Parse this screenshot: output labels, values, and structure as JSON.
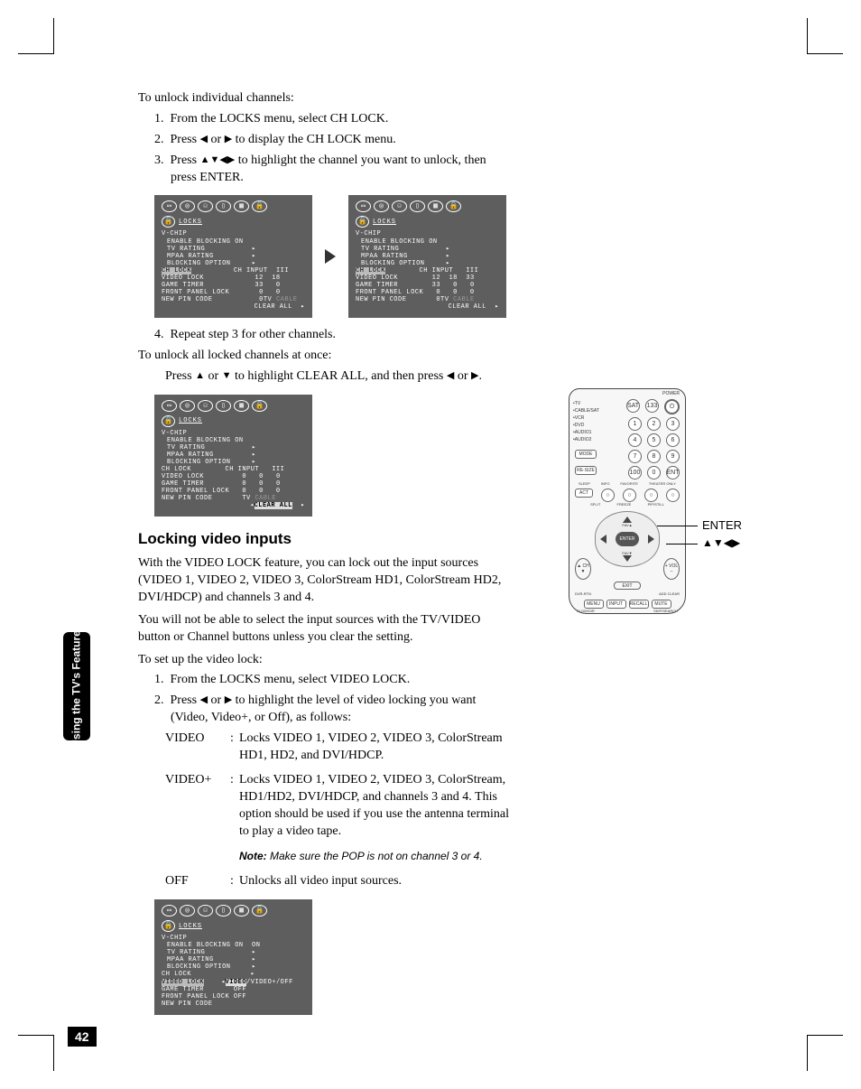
{
  "sidebar": {
    "tab": "Using the TV's\nFeatures",
    "page_num": "42"
  },
  "section1": {
    "intro": "To unlock individual channels:",
    "step1": "From the LOCKS menu, select CH LOCK.",
    "step2_a": "Press ",
    "step2_b": " or ",
    "step2_c": " to display the CH LOCK menu.",
    "step3_a": "Press ",
    "step3_b": " to highlight the channel you want to unlock, then press ENTER.",
    "step4": "Repeat step 3 for other channels.",
    "unlock_all_intro": "To unlock all locked channels at once:",
    "unlock_all_a": "Press ",
    "unlock_all_b": " or ",
    "unlock_all_c": " to highlight CLEAR ALL, and then press ",
    "unlock_all_d": " or ",
    "unlock_all_e": "."
  },
  "section2": {
    "heading": "Locking video inputs",
    "p1": "With the VIDEO LOCK feature, you can lock out the input sources (VIDEO 1, VIDEO 2, VIDEO 3, ColorStream HD1, ColorStream HD2, DVI/HDCP) and channels 3 and 4.",
    "p2": "You will not be able to select the input sources with the TV/VIDEO button or Channel buttons unless you clear the setting.",
    "p3": "To set up the video lock:",
    "step1": "From the LOCKS menu, select VIDEO LOCK.",
    "step2_a": "Press ",
    "step2_b": " or ",
    "step2_c": " to highlight the level of video locking you want (Video, Video+, or Off), as follows:",
    "opt_video_label": "VIDEO",
    "opt_video_body": "Locks VIDEO 1, VIDEO 2, VIDEO 3, ColorStream HD1, HD2, and DVI/HDCP.",
    "opt_videop_label": "VIDEO+",
    "opt_videop_body": "Locks VIDEO 1, VIDEO 2, VIDEO 3, ColorStream, HD1/HD2, DVI/HDCP, and channels 3 and 4. This option should be used if you use the antenna terminal to play a video tape.",
    "note_label": "Note:",
    "note_body": " Make sure the POP is not on channel 3 or 4.",
    "opt_off_label": "OFF",
    "opt_off_body": "Unlocks all video input sources."
  },
  "osd": {
    "title": "LOCKS",
    "l_vchip": "V-CHIP",
    "l_enable": "ENABLE BLOCKING ON",
    "l_tvrating": "TV RATING",
    "l_mpaa": "MPAA RATING",
    "l_blockopt": "BLOCKING OPTION",
    "l_chlock": "CH LOCK",
    "l_chinput": "CH INPUT",
    "l_videolock": "VIDEO LOCK",
    "l_gametimer": "GAME TIMER",
    "l_fplock": "FRONT PANEL LOCK",
    "l_newpin": "NEW PIN CODE",
    "l_clearall": "CLEAR ALL",
    "cols1": "    12  18",
    "cols2": "    33   0",
    "cols3": "     0   0",
    "cols4": "     0",
    "cols_tv": "TV",
    "cols_cable": "CABLE",
    "cols3_iii": "III",
    "colsB1": "  12  18  33",
    "colsB2": "  33   0   0",
    "colsB3": "   0   0   0",
    "colsB4": "   0",
    "colsC1": "III",
    "colsC2": "   0   0   0",
    "video_lock_val": "VIDEO",
    "video_lock_opts": "/VIDEO+/OFF",
    "off": "OFF"
  },
  "remote": {
    "labels": [
      "TV",
      "CABLE/SAT",
      "VCR",
      "DVD",
      "AUDIO1",
      "AUDIO2"
    ],
    "top_btns": [
      "SAT",
      "133"
    ],
    "power": "⏻",
    "mode": "MODE",
    "resize": "RE-SIZE",
    "action": "ACTION\nSET",
    "hundred": "100",
    "zero": "0",
    "ent": "ENT",
    "row_labels": [
      "SLEEP",
      "INFO",
      "FAVORITE",
      "THEATER ONLY"
    ],
    "row_labels2": [
      "SPLIT",
      "FREEZE",
      "PIP/STILL"
    ],
    "fav_up": "FAV▲",
    "fav_dn": "FAV▼",
    "enter": "ENTER",
    "ch": "▲\nCH\n▼",
    "vol": "+\nVOL\n–",
    "exit": "EXIT",
    "dnr": "DVR-RTN",
    "add_clear": "ADD CLEAR",
    "menu": "MENU",
    "input": "INPUT",
    "recall": "RECALL",
    "mute": "MUTE",
    "slow": "SLOW/DIR",
    "skip": "SKIP/SEARCH",
    "callout_enter": "ENTER",
    "callout_arrows": "▲▼◀▶"
  }
}
